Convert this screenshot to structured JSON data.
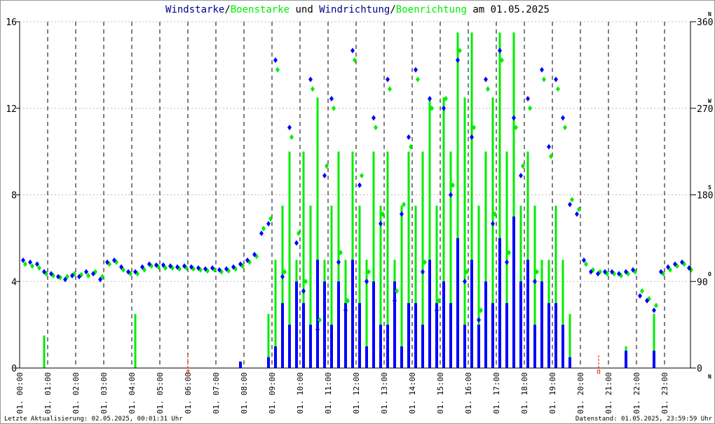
{
  "chart_data": {
    "type": "line",
    "title_parts": [
      {
        "text": "Windstarke",
        "color": "#00008b"
      },
      {
        "text": "/",
        "color": "#000000"
      },
      {
        "text": "Boenstarke",
        "color": "#00ee00"
      },
      {
        "text": " und ",
        "color": "#000000"
      },
      {
        "text": "Windrichtung",
        "color": "#00008b"
      },
      {
        "text": "/",
        "color": "#000000"
      },
      {
        "text": "Boenrichtung",
        "color": "#00ee00"
      },
      {
        "text": " am 01.05.2025",
        "color": "#000000"
      }
    ],
    "y_left": {
      "ticks": [
        "0",
        "4",
        "8",
        "12",
        "16"
      ],
      "range": [
        0,
        16
      ]
    },
    "y_right": {
      "ticks": [
        "0",
        "90",
        "180",
        "270",
        "360"
      ],
      "compass": [
        "N",
        "O",
        "S",
        "W",
        "N"
      ],
      "range": [
        0,
        360
      ]
    },
    "x_ticks": [
      "01. 00:00",
      "01. 01:00",
      "01. 02:00",
      "01. 03:00",
      "01. 04:00",
      "01. 05:00",
      "01. 06:00",
      "01. 07:00",
      "01. 08:00",
      "01. 09:00",
      "01. 10:00",
      "01. 11:00",
      "01. 12:00",
      "01. 13:00",
      "01. 14:00",
      "01. 15:00",
      "01. 16:00",
      "01. 17:00",
      "01. 18:00",
      "01. 19:00",
      "01. 20:00",
      "01. 21:00",
      "01. 22:00",
      "01. 23:00"
    ],
    "x_range_hours": [
      0,
      24
    ],
    "sunrise": {
      "hour": 6.0,
      "label": "a"
    },
    "sunset": {
      "hour": 20.65,
      "label": "u"
    },
    "interval_minutes": 15,
    "series": [
      {
        "name": "Windstarke",
        "color": "#0000ff",
        "kind": "bar",
        "values": [
          0,
          0,
          0,
          0,
          0,
          0,
          0,
          0,
          0,
          0,
          0,
          0,
          0,
          0,
          0,
          0,
          0,
          0,
          0,
          0,
          0,
          0,
          0,
          0,
          0,
          0,
          0,
          0,
          0,
          0,
          0,
          0.3,
          0,
          0,
          0,
          0.5,
          1,
          3,
          2,
          4,
          3,
          2,
          5,
          4,
          2,
          4,
          3,
          5,
          3,
          1,
          4,
          2,
          2,
          4,
          1,
          3,
          3,
          2,
          5,
          3,
          4,
          3,
          6,
          2,
          5,
          2,
          4,
          3,
          6,
          3,
          7,
          4,
          5,
          2,
          4,
          3,
          3,
          2,
          0.5,
          0,
          0,
          0,
          0,
          0,
          0,
          0,
          0.8,
          0,
          0,
          0,
          0.8,
          0,
          0,
          0,
          0,
          0
        ]
      },
      {
        "name": "Boenstarke",
        "color": "#00ee00",
        "kind": "bar",
        "values": [
          0,
          0,
          0,
          1.5,
          0,
          0,
          0,
          0,
          0,
          0,
          0,
          0,
          0,
          0,
          0,
          0,
          2.5,
          0,
          0,
          0,
          0,
          0,
          0,
          0,
          0,
          0,
          0,
          0,
          0,
          0,
          0,
          0,
          0,
          0,
          0,
          2.5,
          5,
          7.5,
          10,
          5,
          10,
          7.5,
          12.5,
          5,
          7.5,
          10,
          5,
          10,
          7.5,
          5,
          10,
          7.5,
          10,
          5,
          7.5,
          10,
          7.5,
          10,
          12.5,
          7.5,
          12.5,
          10,
          15.5,
          12.5,
          15.5,
          7.5,
          10,
          12.5,
          15.5,
          10,
          15.5,
          7.5,
          10,
          7.5,
          5,
          5,
          7.5,
          5,
          2.5,
          0,
          0,
          0,
          0,
          0,
          0,
          0,
          1,
          0,
          0,
          0,
          2.5,
          0,
          0,
          0,
          0,
          0
        ]
      },
      {
        "name": "Windrichtung",
        "color": "#0000ff",
        "kind": "scatter",
        "values": [
          112,
          110,
          108,
          100,
          98,
          95,
          92,
          96,
          95,
          100,
          98,
          92,
          110,
          112,
          105,
          100,
          100,
          105,
          108,
          107,
          107,
          106,
          105,
          106,
          105,
          104,
          103,
          104,
          102,
          103,
          105,
          108,
          112,
          118,
          140,
          150,
          320,
          95,
          250,
          130,
          80,
          300,
          40,
          200,
          280,
          110,
          60,
          330,
          190,
          90,
          260,
          150,
          300,
          70,
          160,
          240,
          310,
          100,
          280,
          60,
          270,
          180,
          320,
          90,
          240,
          50,
          300,
          150,
          330,
          110,
          260,
          200,
          280,
          90,
          310,
          230,
          300,
          260,
          170,
          160,
          112,
          100,
          98,
          100,
          100,
          98,
          100,
          102,
          75,
          70,
          60,
          100,
          105,
          108,
          110,
          104
        ]
      },
      {
        "name": "Boenrichtung",
        "color": "#00ee00",
        "kind": "scatter",
        "values": [
          108,
          106,
          104,
          98,
          96,
          94,
          95,
          98,
          97,
          96,
          100,
          95,
          108,
          110,
          102,
          98,
          98,
          102,
          106,
          105,
          104,
          104,
          103,
          104,
          103,
          102,
          101,
          102,
          100,
          101,
          103,
          106,
          110,
          116,
          145,
          155,
          310,
          100,
          240,
          140,
          90,
          290,
          50,
          210,
          270,
          120,
          70,
          320,
          200,
          100,
          250,
          160,
          290,
          80,
          170,
          230,
          300,
          110,
          270,
          70,
          280,
          190,
          330,
          100,
          250,
          60,
          290,
          160,
          320,
          120,
          250,
          210,
          270,
          100,
          300,
          220,
          290,
          250,
          175,
          165,
          108,
          102,
          100,
          98,
          98,
          96,
          98,
          100,
          80,
          72,
          65,
          98,
          102,
          106,
          108,
          102
        ]
      }
    ]
  },
  "footer": {
    "last_update": "Letzte Aktualisierung: 02.05.2025, 00:01:31 Uhr",
    "data_state": "Datenstand: 01.05.2025, 23:59:59 Uhr"
  }
}
